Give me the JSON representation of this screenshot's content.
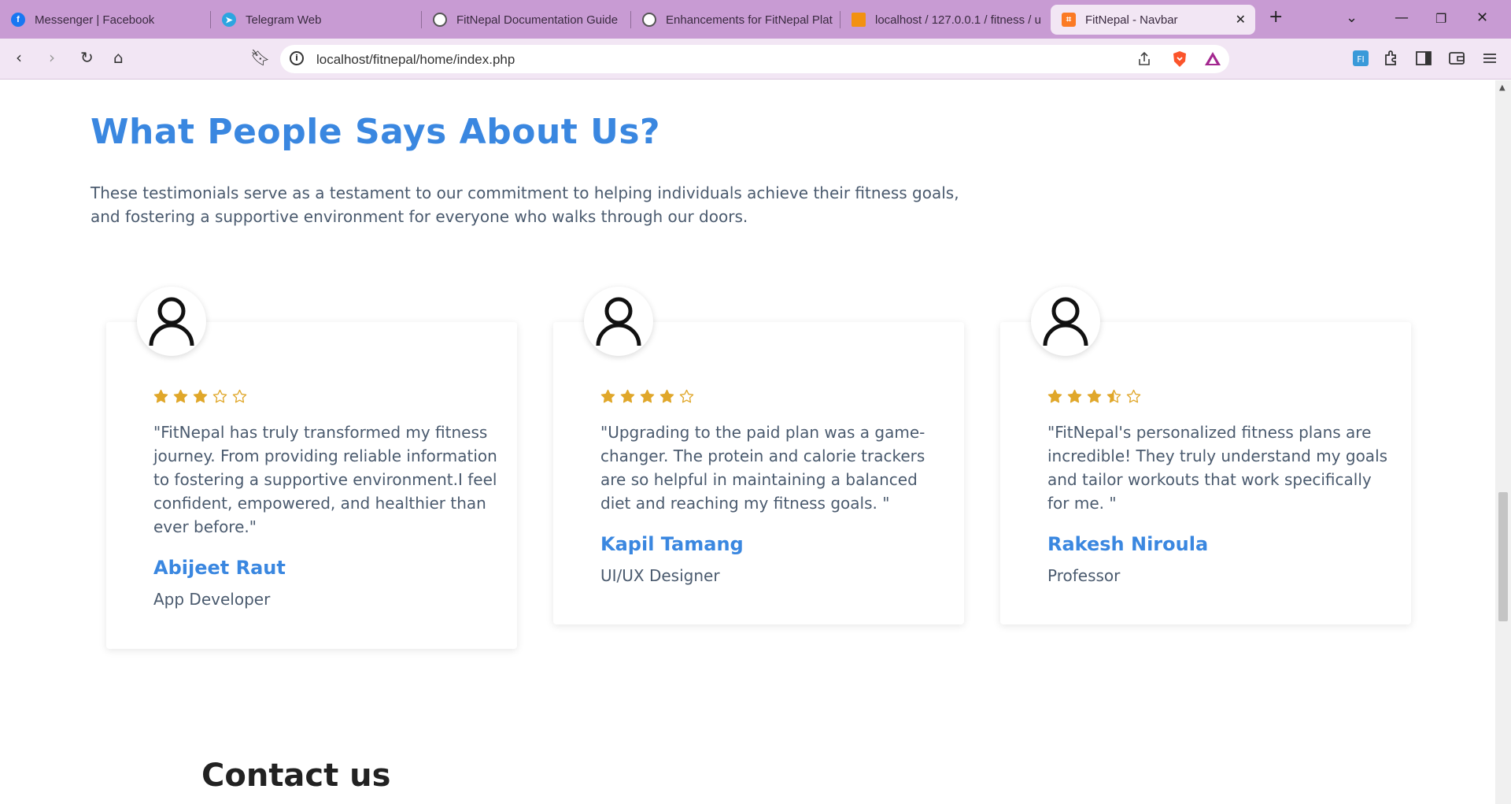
{
  "browser": {
    "tabs": [
      {
        "title": "Messenger | Facebook",
        "icon": "facebook-icon",
        "color": "#1877f2"
      },
      {
        "title": "Telegram Web",
        "icon": "telegram-icon",
        "color": "#2ca5e0"
      },
      {
        "title": "FitNepal Documentation Guide",
        "icon": "openai-icon",
        "color": "#555555"
      },
      {
        "title": "Enhancements for FitNepal Plat",
        "icon": "openai-icon",
        "color": "#555555"
      },
      {
        "title": "localhost / 127.0.0.1 / fitness / u",
        "icon": "phpmyadmin-icon",
        "color": "#f29111"
      },
      {
        "title": "FitNepal - Navbar",
        "icon": "xampp-icon",
        "color": "#fb7a24"
      }
    ],
    "new_tab": "+",
    "url": "localhost/fitnepal/home/index.php"
  },
  "section": {
    "heading": "What People Says About Us?",
    "intro": "These testimonials serve as a testament to our commitment to helping individuals achieve their fitness goals, and fostering a supportive environment for everyone who walks through our doors."
  },
  "testimonials": [
    {
      "rating": 3,
      "quote": "\"FitNepal has truly transformed my fitness journey. From providing reliable information to fostering a supportive environment.I feel confident, empowered, and healthier than ever before.\"",
      "name": "Abijeet Raut",
      "role": "App Developer"
    },
    {
      "rating": 4,
      "quote": "\"Upgrading to the paid plan was a game-changer. The protein and calorie trackers are so helpful in maintaining a balanced diet and reaching my fitness goals. \"",
      "name": "Kapil Tamang",
      "role": "UI/UX Designer"
    },
    {
      "rating": 3.5,
      "quote": "\"FitNepal's personalized fitness plans are incredible! They truly understand my goals and tailor workouts that work specifically for me. \"",
      "name": "Rakesh Niroula",
      "role": "Professor"
    }
  ],
  "contact": {
    "heading": "Contact us"
  },
  "colors": {
    "accent": "#3a87e0",
    "star": "#e0a72a",
    "tabbar": "#c89bd3"
  }
}
